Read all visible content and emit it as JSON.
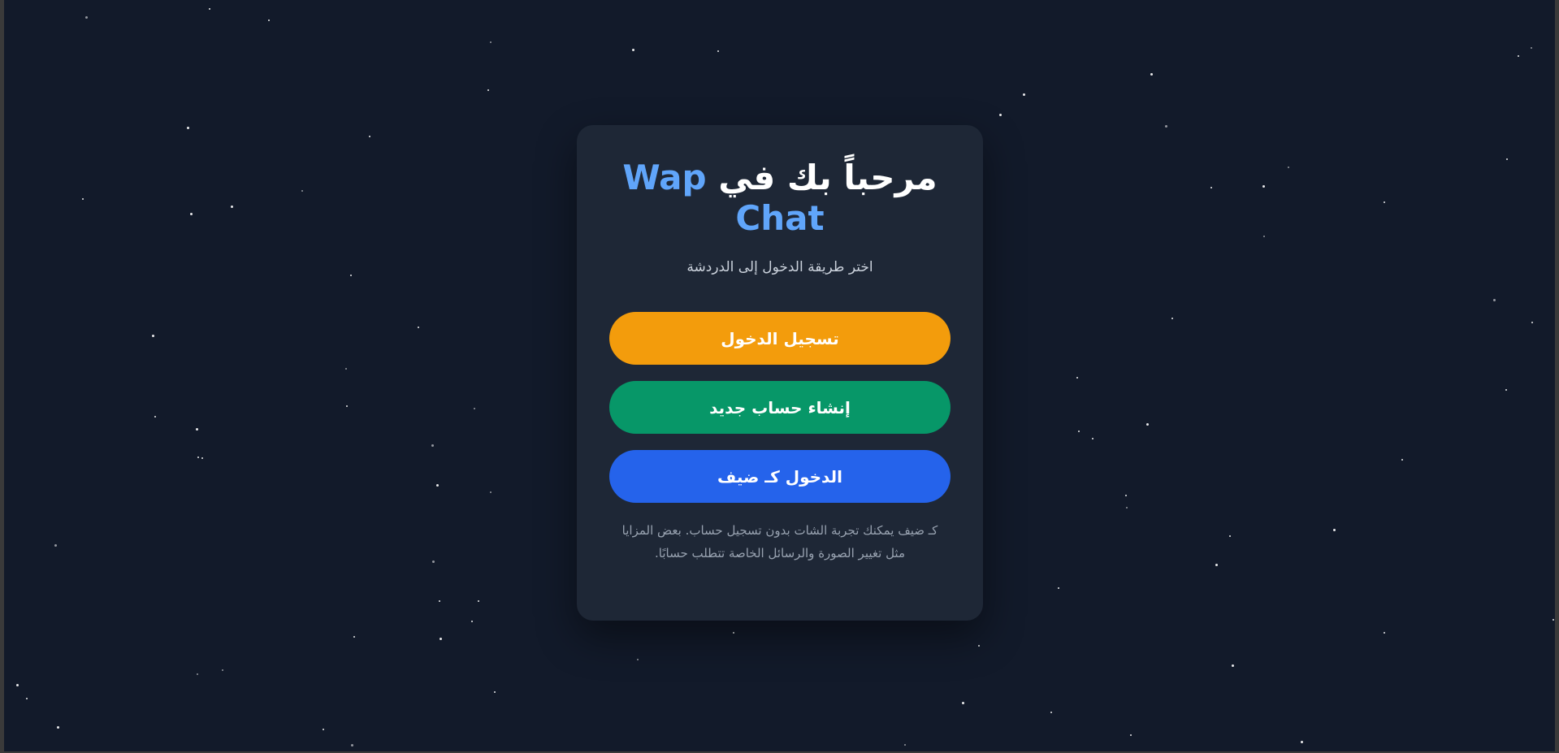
{
  "welcome": {
    "title_prefix": "مرحباً بك في",
    "brand": "Wap Chat",
    "subtitle": "اختر طريقة الدخول إلى الدردشة"
  },
  "actions": {
    "login_label": "تسجيل الدخول",
    "register_label": "إنشاء حساب جديد",
    "guest_label": "الدخول كـ ضيف"
  },
  "guest_note": "كـ ضيف يمكنك تجربة الشات بدون تسجيل حساب. بعض المزايا مثل تغيير الصورة والرسائل الخاصة تتطلب حسابًا.",
  "colors": {
    "background": "#121a2a",
    "card": "#1e2736",
    "brand_accent": "#60a5fa",
    "login_button": "#f39c0c",
    "register_button": "#079768",
    "guest_button": "#2563eb"
  }
}
